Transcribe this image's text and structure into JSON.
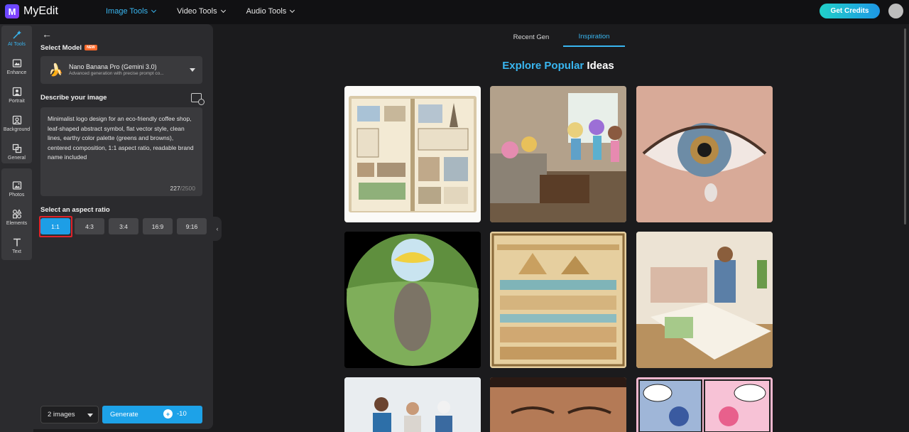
{
  "app": {
    "name": "MyEdit",
    "logo_letter": "M"
  },
  "topnav": [
    {
      "label": "Image Tools",
      "active": true
    },
    {
      "label": "Video Tools",
      "active": false
    },
    {
      "label": "Audio Tools",
      "active": false
    }
  ],
  "header": {
    "credits_label": "Get Credits"
  },
  "rail": {
    "items": [
      {
        "label": "AI Tools",
        "icon": "magic-wand-icon"
      },
      {
        "label": "Enhance",
        "icon": "enhance-icon"
      },
      {
        "label": "Portrait",
        "icon": "portrait-icon"
      },
      {
        "label": "Background",
        "icon": "background-icon"
      },
      {
        "label": "General",
        "icon": "general-icon"
      },
      {
        "label": "Photos",
        "icon": "photos-icon"
      },
      {
        "label": "Elements",
        "icon": "elements-icon"
      },
      {
        "label": "Text",
        "icon": "text-icon"
      }
    ]
  },
  "panel": {
    "select_model_label": "Select Model",
    "new_badge": "NEW",
    "model_name": "Nano Banana Pro (Gemini 3.0)",
    "model_sub": "Advanced generation with precise prompt co...",
    "describe_label": "Describe your image",
    "prompt": "Minimalist logo design for an eco-friendly coffee shop, leaf-shaped abstract symbol, flat vector style, clean lines, earthy color palette (greens and browns), centered composition, 1:1 aspect ratio, readable brand name included",
    "char_count": "227",
    "char_max": "/2500",
    "aspect_label": "Select an aspect ratio",
    "ratios": [
      "1:1",
      "4:3",
      "3:4",
      "16:9",
      "9:16"
    ],
    "selected_ratio": "1:1",
    "image_count": "2 images",
    "generate_label": "Generate",
    "generate_cost": "-10"
  },
  "main": {
    "tabs": [
      {
        "label": "Recent Gen"
      },
      {
        "label": "Inspiration"
      }
    ],
    "active_tab": "Inspiration",
    "heading_highlight": "Explore Popular",
    "heading_rest": " Ideas"
  },
  "colors": {
    "accent": "#39b6f0",
    "button": "#1da2e8",
    "outline_red": "#e0232a",
    "panel": "#2b2b2e"
  }
}
